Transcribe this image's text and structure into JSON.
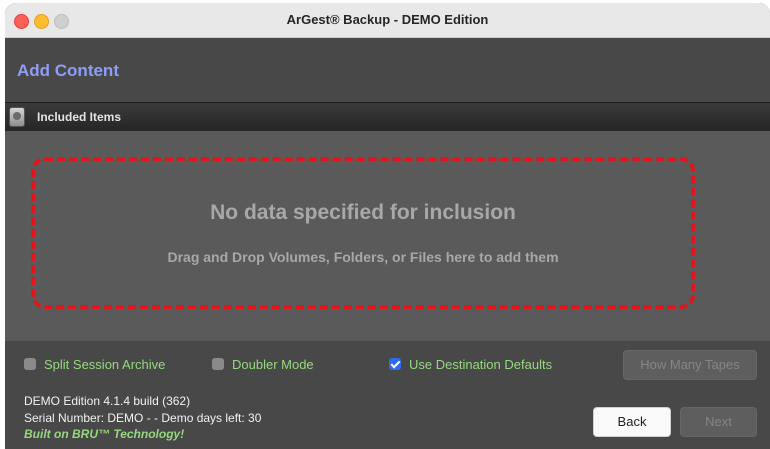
{
  "window": {
    "title": "ArGest® Backup - DEMO Edition"
  },
  "header": {
    "title": "Add Content"
  },
  "included_bar": {
    "label": "Included Items",
    "icon": "disk-icon"
  },
  "dropzone": {
    "title": "No data specified for inclusion",
    "hint": "Drag and Drop Volumes, Folders, or Files here to add them",
    "border_color": "#e3141c"
  },
  "options": {
    "split_session": {
      "label": "Split Session Archive",
      "checked": false
    },
    "doubler_mode": {
      "label": "Doubler Mode",
      "checked": false
    },
    "use_destination_defaults": {
      "label": "Use Destination Defaults",
      "checked": true
    }
  },
  "buttons": {
    "how_many_tapes": {
      "label": "How Many Tapes",
      "enabled": false
    },
    "back": {
      "label": "Back",
      "enabled": true
    },
    "next": {
      "label": "Next",
      "enabled": false
    }
  },
  "info": {
    "edition": "DEMO Edition 4.1.4 build (362)",
    "serial": "Serial Number: DEMO -  - Demo days left: 30",
    "tagline": "Built on BRU™ Technology!"
  },
  "colors": {
    "accent_title": "#8f9cf8",
    "option_text": "#95d87e",
    "checkbox_checked": "#2f6bf0"
  }
}
